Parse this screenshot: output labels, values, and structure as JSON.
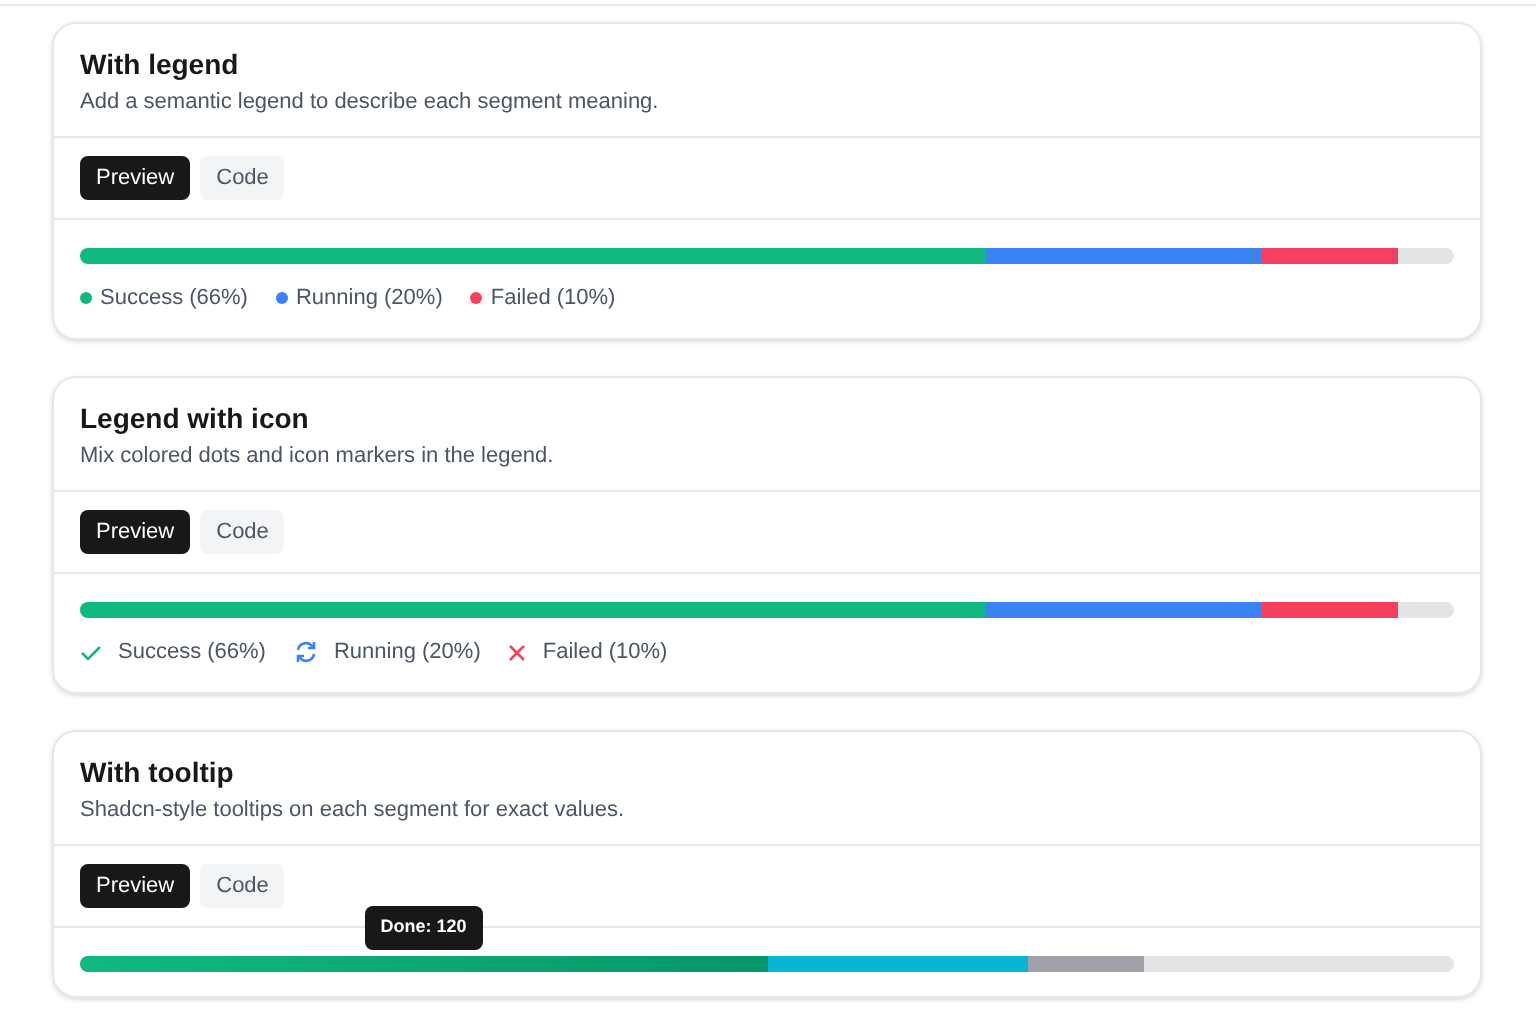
{
  "cards": [
    {
      "title": "With legend",
      "description": "Add a semantic legend to describe each segment meaning.",
      "tabs": [
        {
          "label": "Preview",
          "selected": true
        },
        {
          "label": "Code",
          "selected": false
        }
      ],
      "segments": [
        {
          "level": 0.66,
          "color": "#10b981"
        },
        {
          "color": "#3b82f6"
        },
        {
          "color": "#f43f5e"
        }
      ],
      "legend": [
        {
          "kind": "dot",
          "label": "Success (66%)",
          "color": "#10b981"
        },
        {
          "kind": "dot",
          "label": "Running (20%)",
          "color": "#3b82f6"
        },
        {
          "kind": "dot",
          "label": "Failed (10%)",
          "color": "#f43f5e"
        }
      ]
    },
    {
      "title": "Legend with icon",
      "description": "Mix colored dots and icon markers in the legend.",
      "tabs": [
        {
          "label": "Preview",
          "selected": true
        },
        {
          "label": "Code",
          "selected": false
        }
      ],
      "segments": [
        {
          "level": 0.66,
          "color": "#10b981"
        },
        {
          "color": "#3b82f6"
        },
        {
          "color": "#f43f5e"
        }
      ],
      "legend": [
        {
          "kind": "check",
          "label": "Success (66%)",
          "color": "#10b981"
        },
        {
          "kind": "refresh",
          "label": "Running (20%)",
          "color": "#3b82f6"
        },
        {
          "kind": "cross",
          "label": "Failed (10%)",
          "color": "#f43f5e"
        }
      ]
    },
    {
      "title": "With tooltip",
      "description": "Shadcn-style tooltips on each segment for exact values.",
      "tabs": [
        {
          "label": "Preview",
          "selected": true
        },
        {
          "label": "Code",
          "selected": false
        }
      ],
      "segments": [
        {
          "level": 0.5,
          "color": "#10b981",
          "hovered": true,
          "tooltip": "Done: 120"
        },
        {
          "color": "#06b6d4",
          "hovered": false
        },
        {
          "color": "#a1a1aa",
          "hovered": false
        }
      ]
    }
  ]
}
